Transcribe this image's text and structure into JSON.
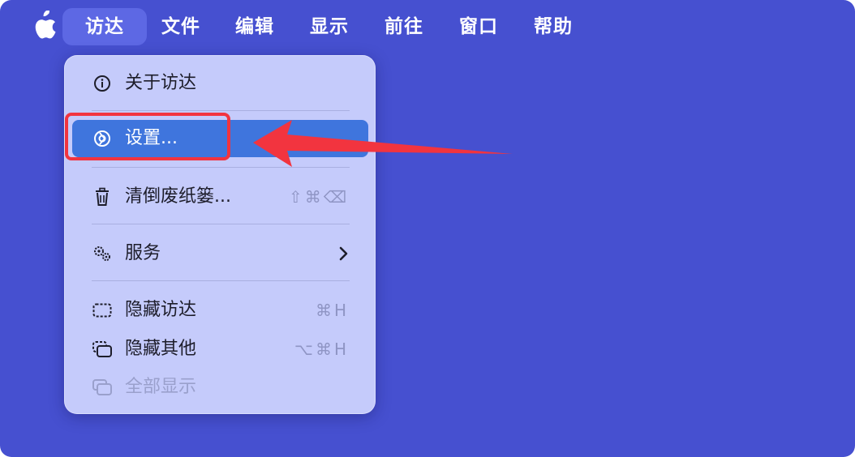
{
  "menubar": {
    "apple_icon": "apple-logo",
    "items": [
      "访达",
      "文件",
      "编辑",
      "显示",
      "前往",
      "窗口",
      "帮助"
    ],
    "active_index": 0
  },
  "finder_menu": {
    "items": [
      {
        "label": "关于访达",
        "icon": "info-circle-icon",
        "shortcut": "",
        "enabled": true
      },
      {
        "label": "设置...",
        "icon": "gear-icon",
        "shortcut": "",
        "enabled": true,
        "highlighted": true
      },
      {
        "label": "清倒废纸篓...",
        "icon": "trash-icon",
        "shortcut": "⇧⌘⌫",
        "enabled": true
      },
      {
        "label": "服务",
        "icon": "services-gears-icon",
        "shortcut": "",
        "enabled": true,
        "has_submenu": true
      },
      {
        "label": "隐藏访达",
        "icon": "hide-window-icon",
        "shortcut": "⌘H",
        "enabled": true
      },
      {
        "label": "隐藏其他",
        "icon": "hide-others-icon",
        "shortcut": "⌥⌘H",
        "enabled": true
      },
      {
        "label": "全部显示",
        "icon": "show-all-icon",
        "shortcut": "",
        "enabled": false
      }
    ]
  },
  "annotation": {
    "target_item": "设置...",
    "color": "#f2343f"
  },
  "colors": {
    "desktop_bg": "#4650d0",
    "menu_bg": "#c5cbfb",
    "highlight": "#3f75dd"
  }
}
